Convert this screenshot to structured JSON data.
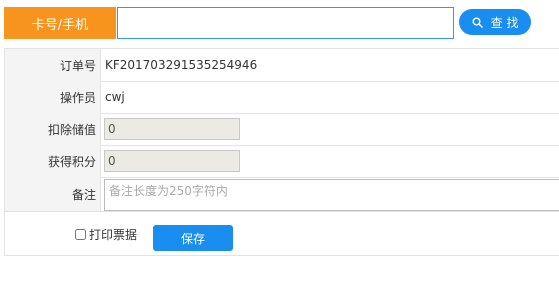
{
  "search": {
    "label": "卡号/手机",
    "value": "",
    "placeholder": "",
    "button_label": "查 找",
    "button_icon": "search-icon"
  },
  "form": {
    "order_no": {
      "label": "订单号",
      "value": "KF201703291535254946"
    },
    "operator": {
      "label": "操作员",
      "value": "cwj"
    },
    "deduct_value": {
      "label": "扣除储值",
      "value": "0"
    },
    "earn_points": {
      "label": "获得积分",
      "value": "0"
    },
    "remarks": {
      "label": "备注",
      "placeholder": "备注长度为250字符内"
    }
  },
  "footer": {
    "print_label": "打印票据",
    "print_checked": false,
    "save_label": "保存"
  },
  "colors": {
    "accent_orange": "#f7941d",
    "primary_blue": "#1a8ef0",
    "label_bg": "#f4f4f4",
    "readonly_bg": "#ebebe4"
  }
}
